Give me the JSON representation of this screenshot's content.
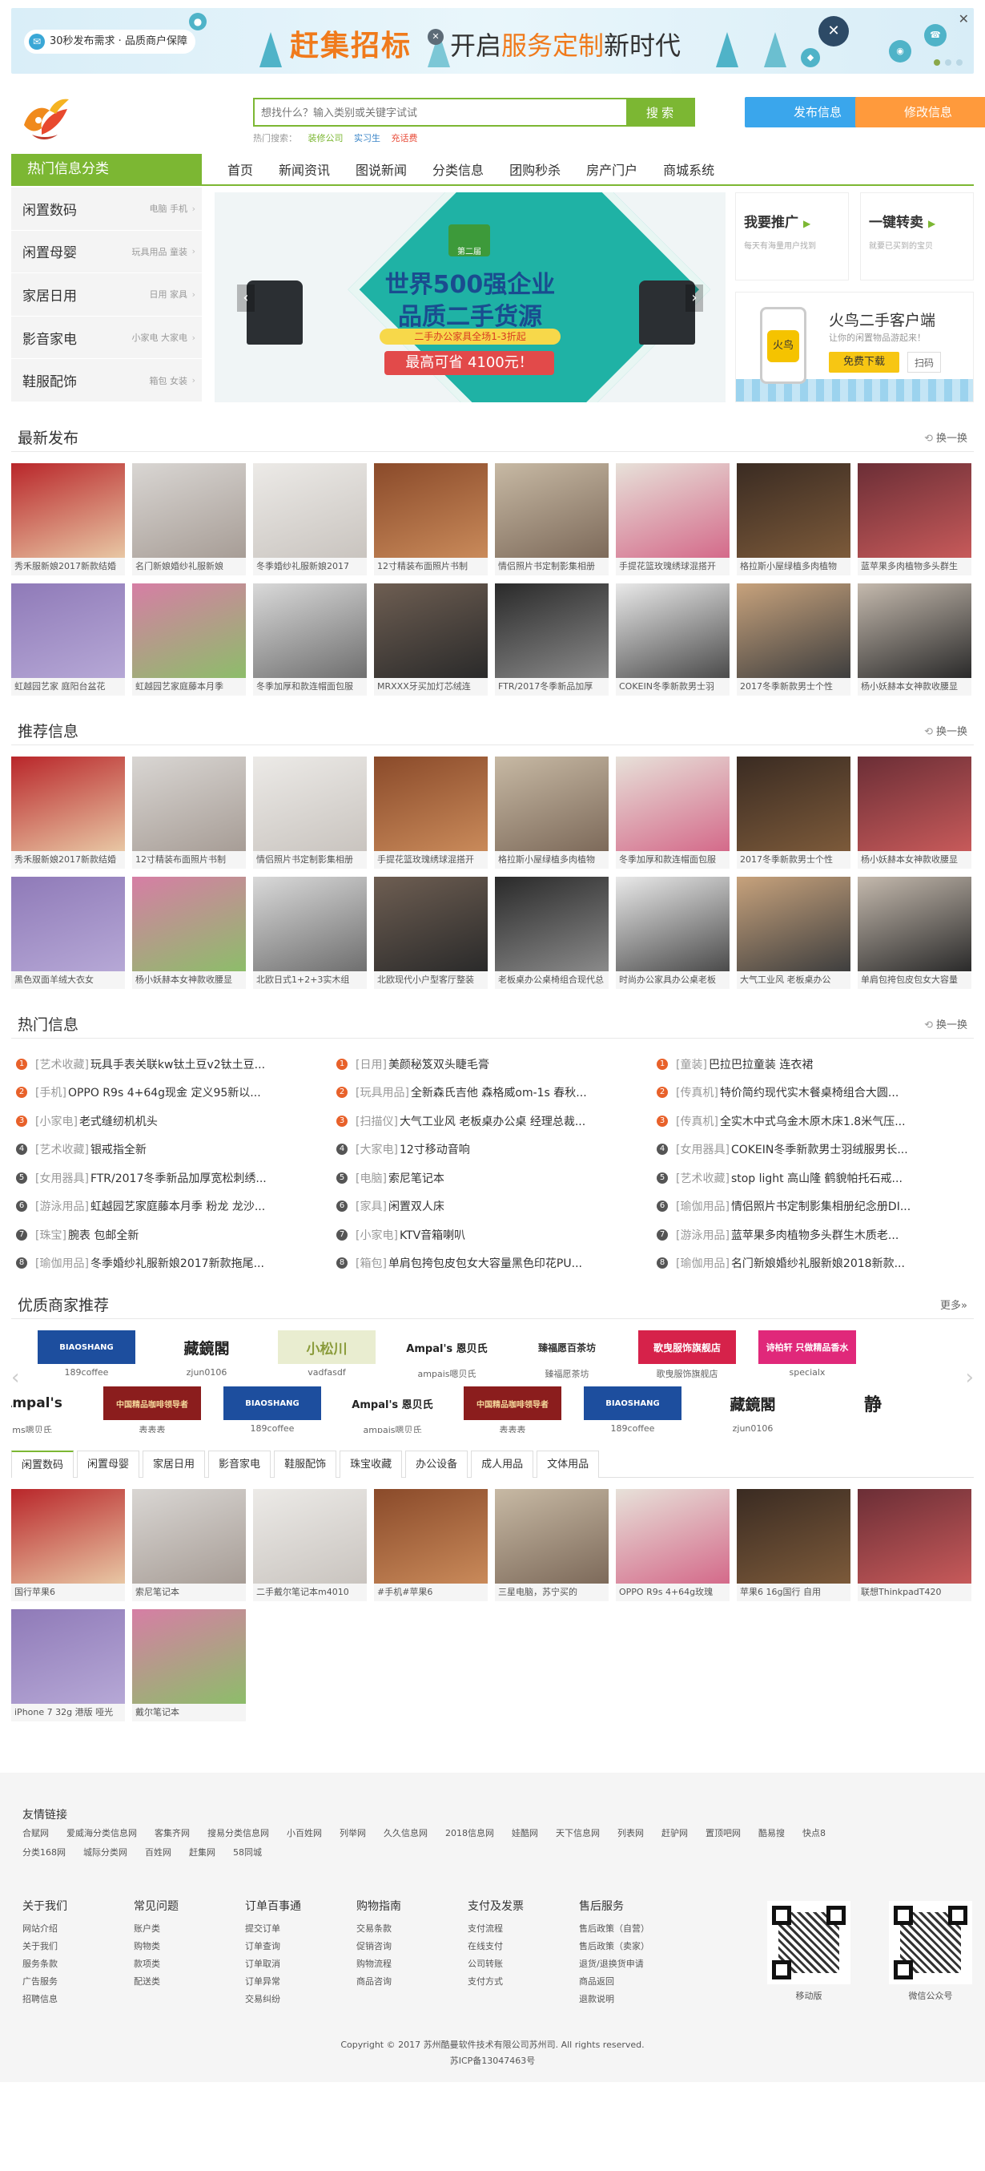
{
  "banner": {
    "pill": "30秒发布需求 · 品质商户保障",
    "title_left": "赶集招标",
    "title_prefix": "开启",
    "title_highlight": "服务定制",
    "title_suffix": "新时代",
    "close": "✕"
  },
  "header": {
    "search_placeholder": "想找什么？输入类别或关键字试试",
    "search_button": "搜 索",
    "hot_label": "热门搜索：",
    "hot_words": [
      "装修公司",
      "实习生",
      "充话费"
    ],
    "publish_button": "发布信息",
    "edit_button": "修改信息"
  },
  "nav": {
    "category_label": "热门信息分类",
    "items": [
      "首页",
      "新闻资讯",
      "图说新闻",
      "分类信息",
      "团购秒杀",
      "房产门户",
      "商城系统"
    ]
  },
  "categories": [
    {
      "name": "闲置数码",
      "sub": "电脑 手机"
    },
    {
      "name": "闲置母婴",
      "sub": "玩具用品 童装"
    },
    {
      "name": "家居日用",
      "sub": "日用 家具"
    },
    {
      "name": "影音家电",
      "sub": "小家电 大家电"
    },
    {
      "name": "鞋服配饰",
      "sub": "箱包 女装"
    }
  ],
  "slider": {
    "logo_text": "第二届",
    "line1": "世界500强企业",
    "line2": "品质二手货源",
    "tag": "二手办公家具全场1-3折起",
    "price": "最高可省 4100元！"
  },
  "side": {
    "promo_title": "我要推广",
    "promo_desc": "每天有海量用户找到",
    "sell_title": "一键转卖",
    "sell_desc": "就要已买到的宝贝",
    "app_title": "火鸟二手客户端",
    "app_desc": "让你的闲置物品游起来！",
    "app_icon": "火鸟",
    "download": "免费下载",
    "scan": "扫码"
  },
  "sections": {
    "latest": "最新发布",
    "recommend": "推荐信息",
    "hot": "热门信息",
    "merchants": "优质商家推荐",
    "refresh": "换一换",
    "more": "更多»"
  },
  "latest": [
    "秀禾服新娘2017新款结婚",
    "名门新娘婚纱礼服新娘",
    "冬季婚纱礼服新娘2017",
    "12寸精装布面照片书制",
    "情侣照片书定制影集相册",
    "手提花篮玫瑰绣球混搭开",
    "格拉斯小屋绿植多肉植物",
    "蓝苹果多肉植物多头群生",
    "虹越园艺家 庭阳台盆花",
    "虹越园艺家庭藤本月季",
    "冬季加厚和款连帽面包服",
    "MRXXX牙买加灯芯绒连",
    "FTR/2017冬季新品加厚",
    "COKEIN冬季新款男士羽",
    "2017冬季新款男士个性",
    "杨小妖赫本女神款收腰显"
  ],
  "recommend": [
    "秀禾服新娘2017新款结婚",
    "12寸精装布面照片书制",
    "情侣照片书定制影集相册",
    "手提花篮玫瑰绣球混搭开",
    "格拉斯小屋绿植多肉植物",
    "冬季加厚和款连帽面包服",
    "2017冬季新款男士个性",
    "杨小妖赫本女神款收腰显",
    "黑色双面羊绒大衣女",
    "杨小妖赫本女神款收腰显",
    "北欧日式1+2+3实木组",
    "北欧现代小户型客厅整装",
    "老板桌办公桌椅组合现代总",
    "时尚办公家具办公桌老板",
    "大气工业风 老板桌办公",
    "单肩包挎包皮包女大容量"
  ],
  "hot": {
    "col1": [
      {
        "cat": "[艺术收藏]",
        "t": "玩具手表关联kw钛土豆v2钛土豆..."
      },
      {
        "cat": "[手机]",
        "t": "OPPO R9s 4+64g现金 定义95新以..."
      },
      {
        "cat": "[小家电]",
        "t": "老式缝纫机机头"
      },
      {
        "cat": "[艺术收藏]",
        "t": "银戒指全新"
      },
      {
        "cat": "[女用器具]",
        "t": "FTR/2017冬季新品加厚宽松刺绣..."
      },
      {
        "cat": "[游泳用品]",
        "t": "虹越园艺家庭藤本月季 粉龙 龙沙..."
      },
      {
        "cat": "[珠宝]",
        "t": "腕表 包邮全新"
      },
      {
        "cat": "[瑜伽用品]",
        "t": "冬季婚纱礼服新娘2017新款拖尾..."
      }
    ],
    "col2": [
      {
        "cat": "[日用]",
        "t": "美颜秘笈双头睫毛膏"
      },
      {
        "cat": "[玩具用品]",
        "t": "全新森氏吉他 森格威om-1s 春秋..."
      },
      {
        "cat": "[扫描仪]",
        "t": "大气工业风 老板桌办公桌 经理总裁..."
      },
      {
        "cat": "[大家电]",
        "t": "12寸移动音响"
      },
      {
        "cat": "[电脑]",
        "t": "索尼笔记本"
      },
      {
        "cat": "[家具]",
        "t": "闲置双人床"
      },
      {
        "cat": "[小家电]",
        "t": "KTV音箱喇叭"
      },
      {
        "cat": "[箱包]",
        "t": "单肩包挎包皮包女大容量黑色印花PU..."
      }
    ],
    "col3": [
      {
        "cat": "[童装]",
        "t": "巴拉巴拉童装 连衣裙"
      },
      {
        "cat": "[传真机]",
        "t": "特价简约现代实木餐桌椅组合大圆..."
      },
      {
        "cat": "[传真机]",
        "t": "全实木中式乌金木原木床1.8米气压..."
      },
      {
        "cat": "[女用器具]",
        "t": "COKEIN冬季新款男士羽绒服男长..."
      },
      {
        "cat": "[艺术收藏]",
        "t": "stop light 高山隆 鹤貌帕托石戒..."
      },
      {
        "cat": "[瑜伽用品]",
        "t": "情侣照片书定制影集相册纪念册DI..."
      },
      {
        "cat": "[游泳用品]",
        "t": "蓝苹果多肉植物多头群生木质老..."
      },
      {
        "cat": "[瑜伽用品]",
        "t": "名门新娘婚纱礼服新娘2018新款..."
      }
    ]
  },
  "merchants_row1": [
    {
      "logo": "BIAOSHANG",
      "name": "189coffee"
    },
    {
      "logo": "藏鏡閣",
      "name": "zjun0106"
    },
    {
      "logo": "小松川",
      "name": "vadfasdf"
    },
    {
      "logo": "Ampal's 恩贝氏",
      "name": "ampais嗯贝氏"
    },
    {
      "logo": "臻福愿百茶坊",
      "name": "臻福愿茶坊"
    },
    {
      "logo": "歌曳服饰旗舰店",
      "name": "歌曳服饰旗舰店"
    },
    {
      "logo": "诗柏轩 只做精品香水",
      "name": "specialx"
    }
  ],
  "merchants_row2": [
    {
      "logo": "Ampal's",
      "name": "ms嗯贝氏"
    },
    {
      "logo": "中国精品咖啡领导者",
      "name": "表表表"
    },
    {
      "logo": "BIAOSHANG",
      "name": "189coffee"
    },
    {
      "logo": "Ampal's 恩贝氏",
      "name": "ampais嗯贝氏"
    },
    {
      "logo": "中国精品咖啡领导者",
      "name": "表表表"
    },
    {
      "logo": "BIAOSHANG",
      "name": "189coffee"
    },
    {
      "logo": "藏鏡閣",
      "name": "zjun0106"
    },
    {
      "logo": "静",
      "name": ""
    }
  ],
  "tabs": [
    "闲置数码",
    "闲置母婴",
    "家居日用",
    "影音家电",
    "鞋服配饰",
    "珠宝收藏",
    "办公设备",
    "成人用品",
    "文体用品"
  ],
  "tab_items": [
    "国行苹果6",
    "索尼笔记本",
    "二手戴尔笔记本m4010",
    "#手机#苹果6",
    "三星电脑，苏宁买的",
    "OPPO R9s 4+64g玫瑰",
    "苹果6 16g国行 自用",
    "联想ThinkpadT420",
    "iPhone 7 32g 港版 哑光",
    "戴尔笔记本"
  ],
  "footer": {
    "links_title": "友情链接",
    "links": [
      "合赋网",
      "爱威海分类信息网",
      "客集齐网",
      "搜易分类信息网",
      "小百姓网",
      "列举网",
      "久久信息网",
      "2018信息网",
      "娃酷网",
      "天下信息网",
      "列表网",
      "赶驴网",
      "置顶吧网",
      "酷易搜",
      "快点8",
      "分类168网",
      "城际分类网",
      "百姓网",
      "赶集网",
      "58同城"
    ],
    "cols": [
      {
        "h": "关于我们",
        "items": [
          "网站介绍",
          "关于我们",
          "服务条款",
          "广告服务",
          "招聘信息"
        ]
      },
      {
        "h": "常见问题",
        "items": [
          "账户类",
          "购物类",
          "款项类",
          "配送类"
        ]
      },
      {
        "h": "订单百事通",
        "items": [
          "提交订单",
          "订单查询",
          "订单取消",
          "订单异常",
          "交易纠纷"
        ]
      },
      {
        "h": "购物指南",
        "items": [
          "交易条款",
          "促销咨询",
          "购物流程",
          "商品咨询"
        ]
      },
      {
        "h": "支付及发票",
        "items": [
          "支付流程",
          "在线支付",
          "公司转账",
          "支付方式"
        ]
      },
      {
        "h": "售后服务",
        "items": [
          "售后政策（自营）",
          "售后政策（卖家）",
          "退货/退换货申请",
          "商品返回",
          "退款说明"
        ]
      }
    ],
    "qr1": "移动版",
    "qr2": "微信公众号",
    "copyright": "Copyright © 2017 苏州酷曼软件技术有限公司苏州司. All rights reserved.",
    "icp": "苏ICP备13047463号"
  },
  "colors": {
    "brand": "#7cb733",
    "publish": "#3aa6ec",
    "edit": "#ff9a3c",
    "accent": "#f07a1b"
  }
}
